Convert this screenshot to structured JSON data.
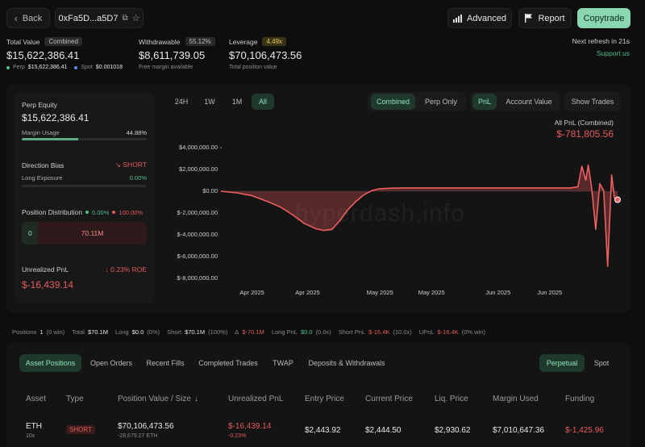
{
  "nav": {
    "back_label": "Back",
    "address": "0xFa5D...a5D7",
    "advanced_label": "Advanced",
    "report_label": "Report",
    "copytrade_label": "Copytrade"
  },
  "summary": {
    "total_value_label": "Total Value",
    "total_value_badge": "Combined",
    "total_value": "$15,622,386.41",
    "perp_label": "Perp",
    "perp_value": "$15,622,386.41",
    "spot_label": "Spot",
    "spot_value": "$0.001018",
    "withdrawable_label": "Withdrawable",
    "withdrawable_badge": "55.12%",
    "withdrawable": "$8,611,739.05",
    "withdrawable_sub": "Free margin available",
    "leverage_label": "Leverage",
    "leverage_badge": "4.49x",
    "leverage_value": "$70,106,473.56",
    "leverage_sub": "Total position value",
    "refresh_text": "Next refresh in 21s",
    "support_label": "Support us"
  },
  "left_panel": {
    "perp_equity_label": "Perp Equity",
    "perp_equity": "$15,622,386.41",
    "margin_usage_label": "Margin Usage",
    "margin_usage_value": "44.88%",
    "margin_usage_fraction": 0.4488,
    "direction_bias_label": "Direction Bias",
    "direction_bias_value": "SHORT",
    "long_exposure_label": "Long Exposure",
    "long_exposure_value": "0.00%",
    "position_distribution_label": "Position Distribution",
    "long_pct": "0.00%",
    "short_pct": "100.00%",
    "dist_left_value": "0",
    "dist_right_value": "70.11M",
    "unrealized_label": "Unrealized PnL",
    "roe_value": "0.23% ROE",
    "unrealized_value": "$-16,439.14"
  },
  "chart_controls": {
    "time_ranges": [
      "24H",
      "1W",
      "1M",
      "All"
    ],
    "active_range": "All",
    "modes": [
      "Combined",
      "Perp Only"
    ],
    "active_mode": "Combined",
    "views": [
      "PnL",
      "Account Value"
    ],
    "active_view": "PnL",
    "show_trades_label": "Show Trades",
    "pnl_title": "All PnL (Combined)",
    "pnl_value": "$-781,805.56"
  },
  "chart_data": {
    "type": "area",
    "title": "",
    "xlabel": "",
    "ylabel": "",
    "ylim": [
      -8000000,
      4000000
    ],
    "yticks": [
      "$4,000,000.00",
      "$2,000,000.00",
      "$0.00",
      "$-2,000,000.00",
      "$-4,000,000.00",
      "$-6,000,000.00",
      "$-8,000,000.00"
    ],
    "ytick_values": [
      4000000,
      2000000,
      0,
      -2000000,
      -4000000,
      -6000000,
      -8000000
    ],
    "xticks": [
      "Apr 2025",
      "Apr 2025",
      "May 2025",
      "May 2025",
      "Jun 2025",
      "Jun 2025"
    ],
    "xlim": [
      0,
      100
    ],
    "grid": false,
    "watermark": "hyperdash.info",
    "series": [
      {
        "x": [
          0,
          4,
          8,
          12,
          15,
          18,
          21,
          24,
          26,
          28,
          30,
          32,
          34,
          36,
          38,
          40,
          43,
          46,
          48,
          50,
          55,
          60,
          65,
          70,
          75,
          80,
          85,
          88,
          90,
          91,
          92,
          92.6,
          93.4,
          94.5,
          95.5,
          96.5,
          97.5,
          98.5,
          99.2,
          100
        ],
        "values": [
          0,
          -150000,
          -420000,
          -980000,
          -1450000,
          -2150000,
          -2950000,
          -3450000,
          -3600000,
          -3500000,
          -2700000,
          -1700000,
          -950000,
          -350000,
          50000,
          230000,
          280000,
          300000,
          300000,
          300000,
          300000,
          300000,
          300000,
          300000,
          300000,
          300000,
          300000,
          300000,
          400000,
          2300000,
          1000000,
          2400000,
          500000,
          -3500000,
          700000,
          50000,
          -6900000,
          1500000,
          -600000,
          -781805.56
        ]
      }
    ]
  },
  "stats_strip": {
    "positions_label": "Positions",
    "positions_value": "1",
    "positions_note": "(0 win)",
    "total_label": "Total",
    "total_value": "$70.1M",
    "long_label": "Long",
    "long_value": "$0.0",
    "long_note": "(0%)",
    "short_label": "Short",
    "short_value": "$70.1M",
    "short_note": "(100%)",
    "delta_label": "Δ",
    "delta_value": "$-70.1M",
    "long_pnl_label": "Long PnL",
    "long_pnl_value": "$0.0",
    "long_pnl_note": "(0.0x)",
    "short_pnl_label": "Short PnL",
    "short_pnl_value": "$-16.4K",
    "short_pnl_note": "(10.0x)",
    "upnl_label": "UPnL",
    "upnl_value": "$-16.4K",
    "upnl_note": "(0% win)"
  },
  "tabs": {
    "items": [
      "Asset Positions",
      "Open Orders",
      "Recent Fills",
      "Completed Trades",
      "TWAP",
      "Deposits & Withdrawals"
    ],
    "active": "Asset Positions",
    "market_items": [
      "Perpetual",
      "Spot"
    ],
    "active_market": "Perpetual"
  },
  "table": {
    "headers": [
      "Asset",
      "Type",
      "Position Value / Size",
      "Unrealized PnL",
      "Entry Price",
      "Current Price",
      "Liq. Price",
      "Margin Used",
      "Funding"
    ],
    "rows": [
      {
        "asset": "ETH",
        "leverage": "10x",
        "type": "SHORT",
        "position_value": "$70,106,473.56",
        "size": "-28,679.27 ETH",
        "unrealized_pnl": "$-16,439.14",
        "unrealized_pct": "-0.23%",
        "entry_price": "$2,443.92",
        "current_price": "$2,444.50",
        "liq_price": "$2,930.62",
        "margin_used": "$7,010,647.36",
        "funding": "$-1,425.96"
      }
    ]
  },
  "colors": {
    "accent_green": "#4fbf8a",
    "loss_red": "#e45b5b",
    "copytrade_bg": "#8ad6b0"
  }
}
